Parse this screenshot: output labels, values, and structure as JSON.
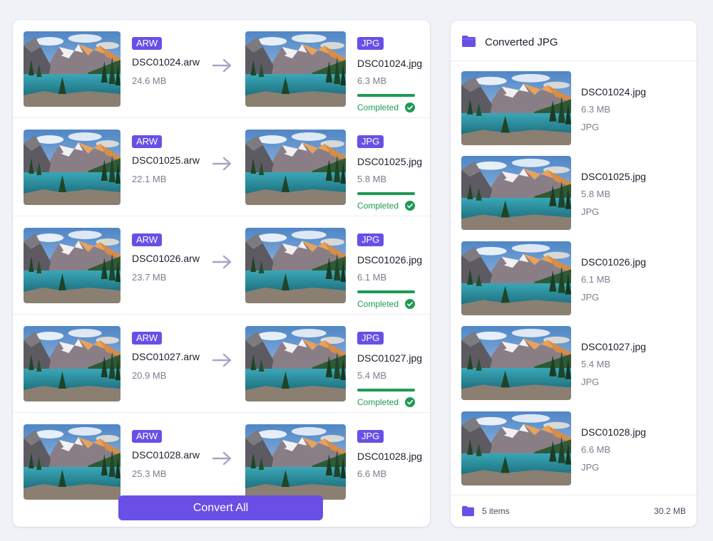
{
  "conversion": {
    "rows": [
      {
        "src_format": "ARW",
        "src_name": "DSC01024.arw",
        "src_size": "24.6 MB",
        "dst_format": "JPG",
        "dst_name": "DSC01024.jpg",
        "dst_size": "6.3 MB",
        "status": "Completed",
        "progress": 1.0
      },
      {
        "src_format": "ARW",
        "src_name": "DSC01025.arw",
        "src_size": "22.1 MB",
        "dst_format": "JPG",
        "dst_name": "DSC01025.jpg",
        "dst_size": "5.8 MB",
        "status": "Completed",
        "progress": 1.0
      },
      {
        "src_format": "ARW",
        "src_name": "DSC01026.arw",
        "src_size": "23.7 MB",
        "dst_format": "JPG",
        "dst_name": "DSC01026.jpg",
        "dst_size": "6.1 MB",
        "status": "Completed",
        "progress": 1.0
      },
      {
        "src_format": "ARW",
        "src_name": "DSC01027.arw",
        "src_size": "20.9 MB",
        "dst_format": "JPG",
        "dst_name": "DSC01027.jpg",
        "dst_size": "5.4 MB",
        "status": "Completed",
        "progress": 1.0
      },
      {
        "src_format": "ARW",
        "src_name": "DSC01028.arw",
        "src_size": "25.3 MB",
        "dst_format": "JPG",
        "dst_name": "DSC01028.jpg",
        "dst_size": "6.6 MB",
        "status": null,
        "progress": null
      }
    ],
    "convert_all_label": "Convert All"
  },
  "output": {
    "title": "Converted JPG",
    "items": [
      {
        "name": "DSC01024.jpg",
        "size": "6.3 MB",
        "type": "JPG"
      },
      {
        "name": "DSC01025.jpg",
        "size": "5.8 MB",
        "type": "JPG"
      },
      {
        "name": "DSC01026.jpg",
        "size": "6.1 MB",
        "type": "JPG"
      },
      {
        "name": "DSC01027.jpg",
        "size": "5.4 MB",
        "type": "JPG"
      },
      {
        "name": "DSC01028.jpg",
        "size": "6.6 MB",
        "type": "JPG"
      }
    ],
    "footer_count": "5 items",
    "footer_total": "30.2 MB"
  },
  "colors": {
    "accent": "#6a4fe6",
    "success": "#1e9a55",
    "muted_text": "#7b7e8f"
  },
  "icons": {
    "arrow": "arrow-right-icon",
    "check": "check-circle-icon",
    "folder": "folder-icon",
    "thumbnail": "mountain-lake-landscape"
  }
}
